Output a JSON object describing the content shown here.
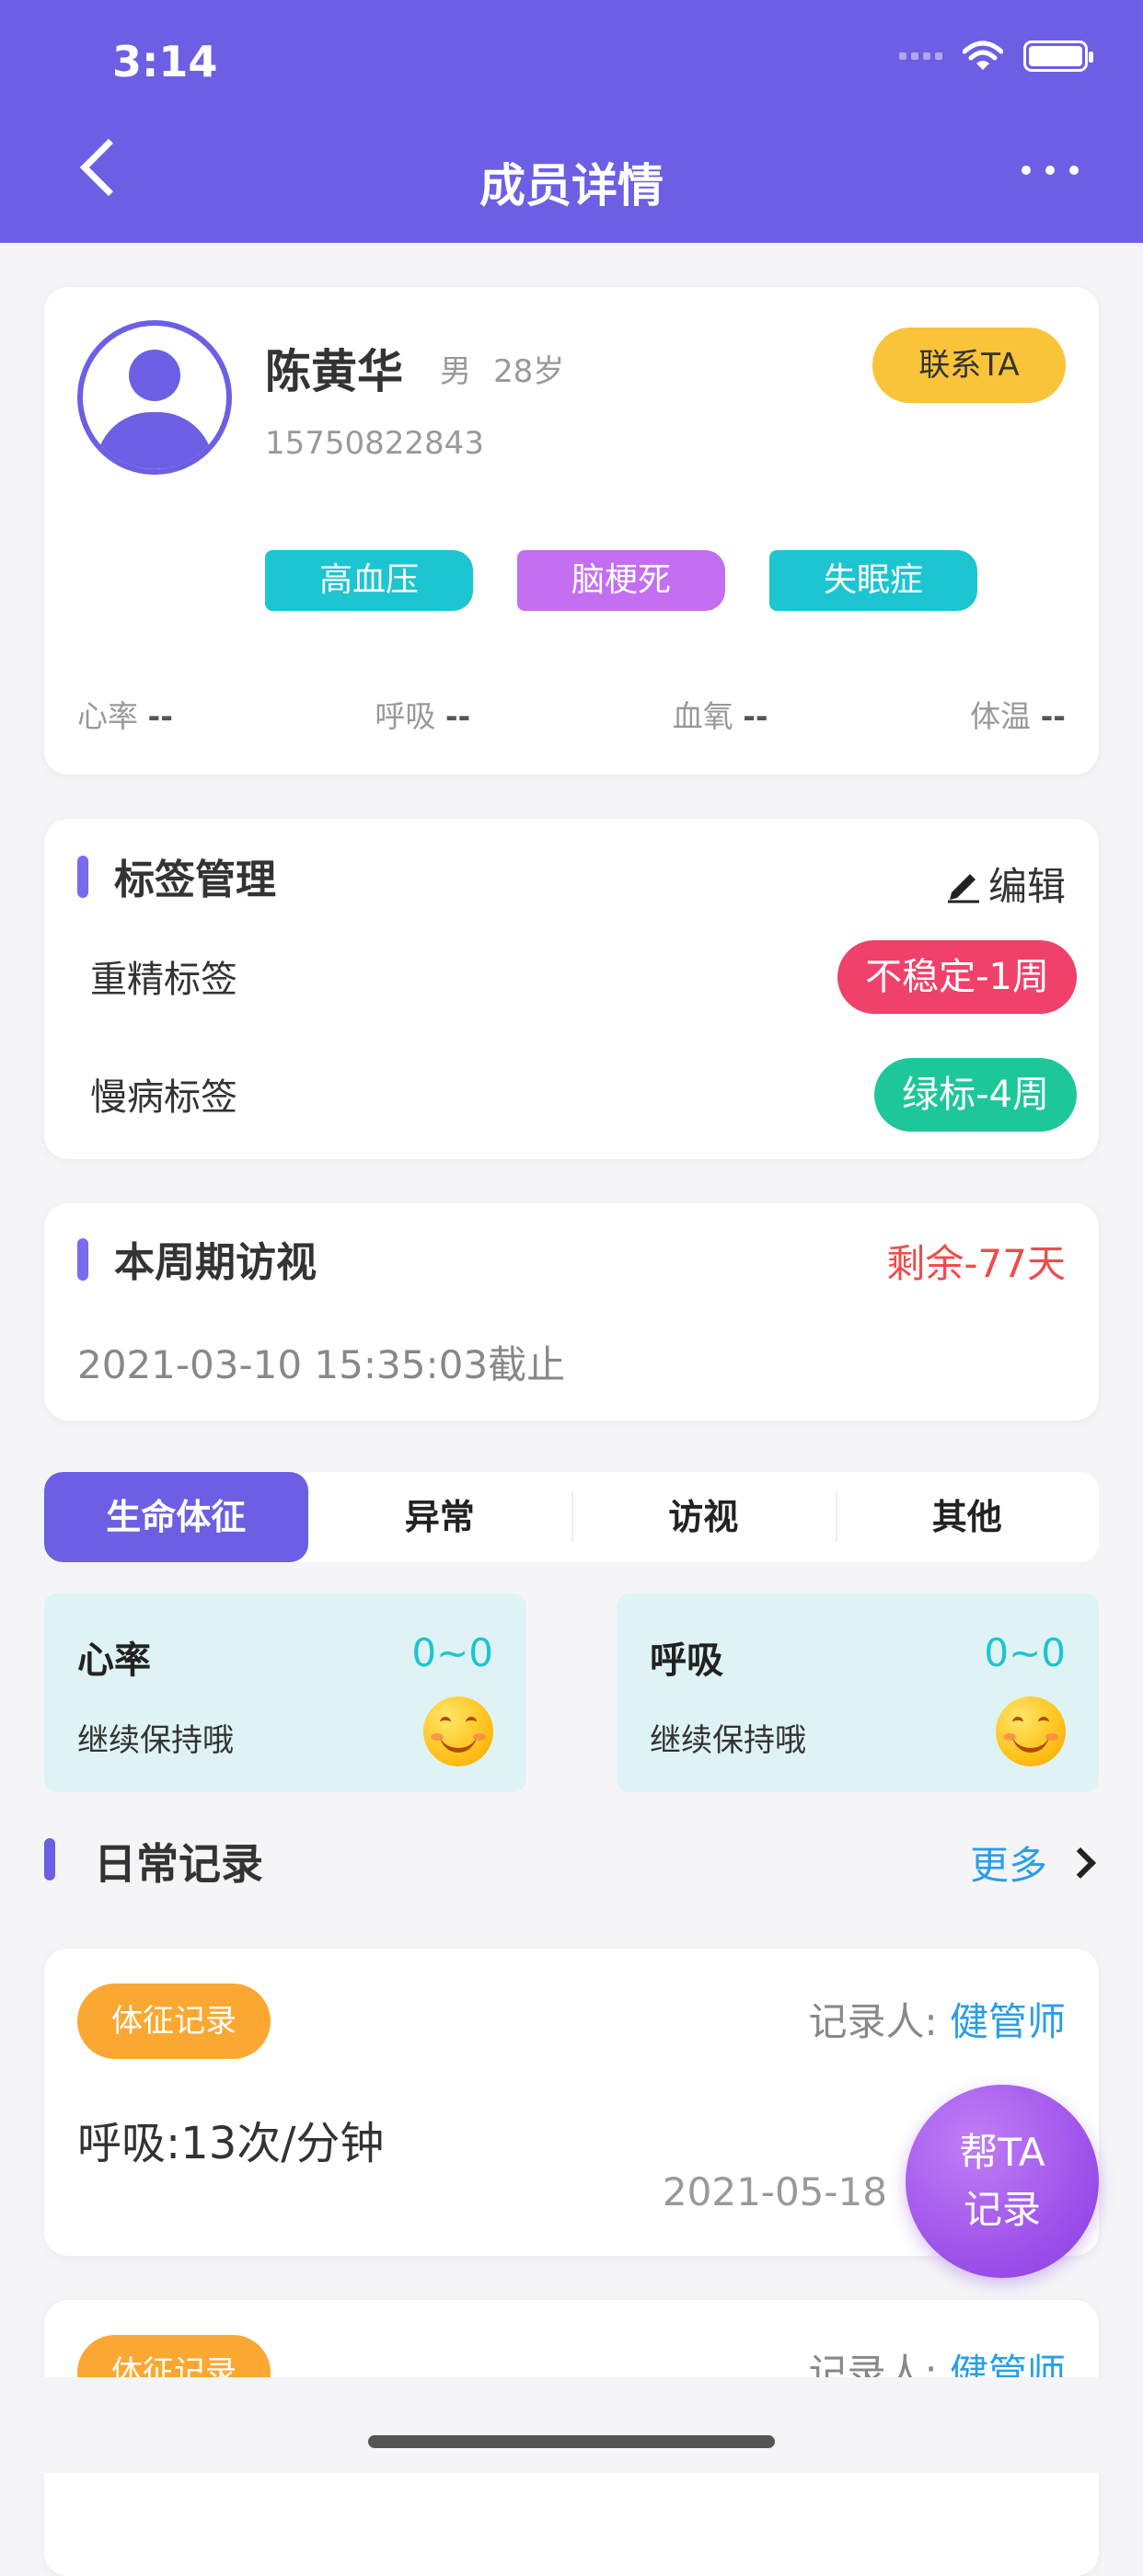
{
  "status_bar": {
    "time": "3:14"
  },
  "nav": {
    "title": "成员详情"
  },
  "profile": {
    "name": "陈黄华",
    "gender": "男",
    "age": "28岁",
    "phone": "15750822843",
    "contact_label": "联系TA",
    "tags": [
      {
        "label": "高血压",
        "color": "#1cc5cf"
      },
      {
        "label": "脑梗死",
        "color": "#c46ef2"
      },
      {
        "label": "失眠症",
        "color": "#1cc5cf"
      }
    ],
    "vitals": [
      {
        "label": "心率",
        "value": "--"
      },
      {
        "label": "呼吸",
        "value": "--"
      },
      {
        "label": "血氧",
        "value": "--"
      },
      {
        "label": "体温",
        "value": "--"
      }
    ]
  },
  "tag_management": {
    "title": "标签管理",
    "edit_label": "编辑",
    "rows": [
      {
        "label": "重精标签",
        "value": "不稳定-1周",
        "color": "#f0416a"
      },
      {
        "label": "慢病标签",
        "value": "绿标-4周",
        "color": "#1dc79a"
      }
    ]
  },
  "visit": {
    "title": "本周期访视",
    "remaining": "剩余-77天",
    "deadline": "2021-03-10 15:35:03截止"
  },
  "tabs": [
    "生命体征",
    "异常",
    "访视",
    "其他"
  ],
  "active_tab": "生命体征",
  "vital_cards": [
    {
      "name": "心率",
      "value": "0~0",
      "note": "继续保持哦"
    },
    {
      "name": "呼吸",
      "value": "0~0",
      "note": "继续保持哦"
    }
  ],
  "daily": {
    "title": "日常记录",
    "more_label": "更多"
  },
  "records": [
    {
      "badge": "体征记录",
      "recorder_label": "记录人:",
      "recorder": "健管师",
      "text": "呼吸:13次/分钟",
      "date": "2021-05-18"
    },
    {
      "badge": "体征记录",
      "recorder_label": "记录人:",
      "recorder": "健管师"
    }
  ],
  "fab": {
    "line1": "帮TA",
    "line2": "记录"
  },
  "colors": {
    "primary": "#6c5fe4",
    "accent_blue": "#2a9ee8",
    "warn_red": "#f04b4b"
  }
}
